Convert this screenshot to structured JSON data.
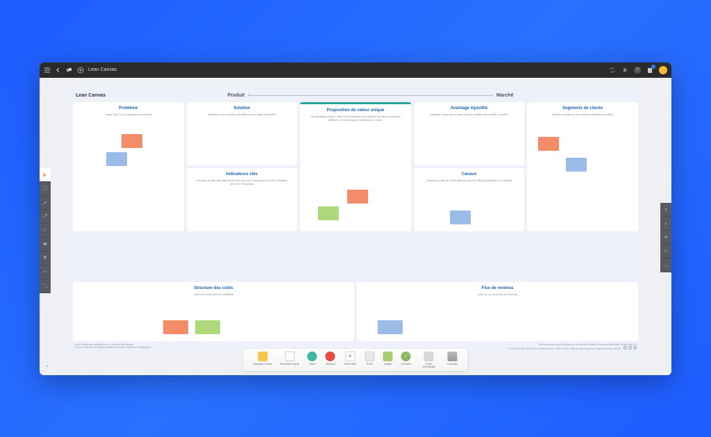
{
  "topbar": {
    "title": "Lean Canvas"
  },
  "canvas": {
    "title": "Lean Canvas",
    "axis_left": "Produit",
    "axis_right": "Marché"
  },
  "cards": {
    "probleme": {
      "title": "Problème",
      "sub": "Listez vos 1 à 3 principaux problèmes"
    },
    "solution": {
      "title": "Solution",
      "sub": "Esquissez une solution possible pour chaque problème"
    },
    "proposition": {
      "title": "Proposition de valeur unique",
      "sub": "Un message unique, clair et convaincant qui explique pourquoi vous êtes différent et méritez qu'on s'intéresse à vous."
    },
    "avantage": {
      "title": "Avantage injustifié",
      "sub": "Quelque chose qui ne peut pas être facilement acheté ou copié"
    },
    "segments": {
      "title": "Segments de clients",
      "sub": "Dressez la liste de vos clients et utilisateurs cibles"
    },
    "indicateurs": {
      "title": "Indicateurs clés",
      "sub": "Dressez la liste des indicateurs clés qui vous renseignent sur les résultats de votre entreprise"
    },
    "canaux": {
      "title": "Canaux",
      "sub": "Dressez la liste de votre chemin vers les clients (entrants ou sortants)"
    },
    "couts": {
      "title": "Structure des coûts",
      "sub": "Liste des coûts fixes et variables"
    },
    "revenus": {
      "title": "Flux de revenus",
      "sub": "Liste de vos sources de revenus"
    }
  },
  "footer": {
    "left1": "Lean Canvas par leanstack.com. Créé par Ash Maurya.",
    "left2": "Le Lean Canvas est adapté du Business Model Canvas de Strategyzer.",
    "right1": "Œuvre soumise aux conditions de la Licence Creative Commons Attribution-Share Alike 3.0",
    "right2": "Pour consulter une copie de cette licence, visitez le site : http://creativecommons.org/licenses/by-sa/3.0/"
  },
  "bottom_tools": [
    {
      "label": "Standard notes"
    },
    {
      "label": "Standard cards"
    },
    {
      "label": "Team"
    },
    {
      "label": "Stickers"
    },
    {
      "label": "Texte libre"
    },
    {
      "label": "Rolls"
    },
    {
      "label": "Image"
    },
    {
      "label": "Choices"
    },
    {
      "label": "Zone d'échange"
    },
    {
      "label": "Corbeille"
    }
  ]
}
